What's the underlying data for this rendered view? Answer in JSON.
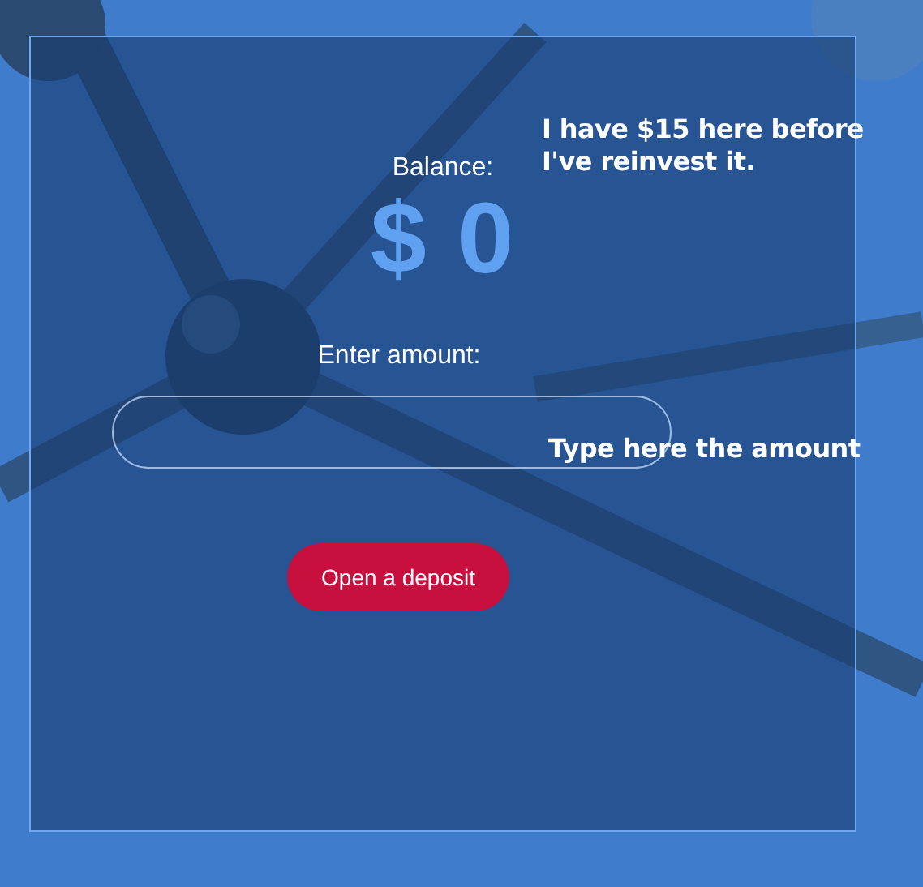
{
  "balance": {
    "label": "Balance:",
    "value": "$ 0"
  },
  "notes": [
    {
      "text": "I have $15 here before I've reinvest it.",
      "kind": "balance"
    },
    {
      "text": "Type here the amount",
      "kind": "field"
    }
  ],
  "amount": {
    "label": "Enter amount:"
  },
  "buttons": [
    {
      "label": "Open a deposit"
    }
  ]
}
